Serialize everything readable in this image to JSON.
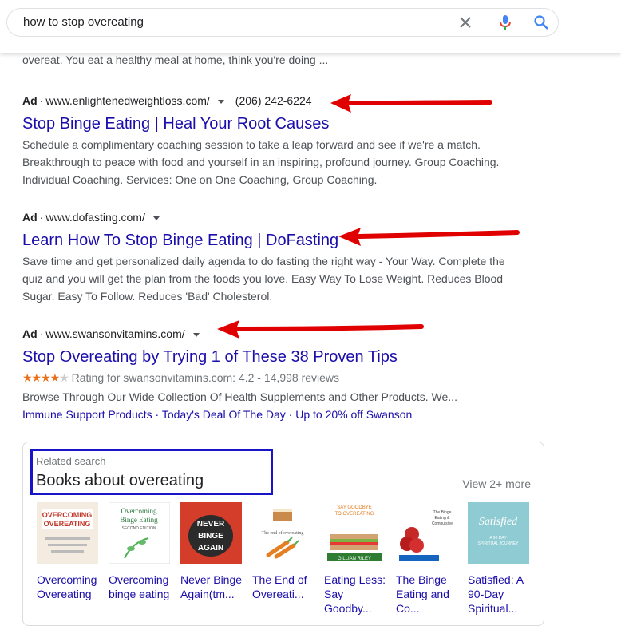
{
  "search": {
    "query": "how to stop overeating"
  },
  "top_snippet": "overeat. You eat a healthy meal at home, think you're doing ...",
  "ads": [
    {
      "label": "Ad",
      "url": "www.enlightenedweightloss.com/",
      "phone": "(206) 242-6224",
      "title": "Stop Binge Eating | Heal Your Root Causes",
      "desc_lines": [
        "Schedule a complimentary coaching session to take a leap forward and see if we're a match.",
        "Breakthrough to peace with food and yourself in an inspiring, profound journey. Group Coaching.",
        "Individual Coaching. Services: One on One Coaching, Group Coaching."
      ]
    },
    {
      "label": "Ad",
      "url": "www.dofasting.com/",
      "title": "Learn How To Stop Binge Eating | DoFasting",
      "desc_lines": [
        "Save time and get personalized daily agenda to do fasting the right way - Your Way. Complete the",
        "quiz and you will get the plan from the foods you love. Easy Way To Lose Weight. Reduces Blood",
        "Sugar. Easy To Follow. Reduces 'Bad' Cholesterol."
      ]
    },
    {
      "label": "Ad",
      "url": "www.swansonvitamins.com/",
      "title": "Stop Overeating by Trying 1 of These 38 Proven Tips",
      "rating_text": "Rating for swansonvitamins.com: 4.2 - 14,998 reviews",
      "rating_value": 4.2,
      "desc_lines": [
        "Browse Through Our Wide Collection Of Health Supplements and Other Products. We..."
      ],
      "sitelinks": [
        "Immune Support Products",
        "Today's Deal Of The Day",
        "Up to 20% off Swanson"
      ]
    }
  ],
  "related": {
    "small_label": "Related search",
    "title": "Books about overeating",
    "view_more": "View 2+ more",
    "books": [
      {
        "title_lines": [
          "Overcoming",
          "Overeating"
        ],
        "cover_text": "OVERCOMING OVEREATING",
        "cover_bg": "#f4ece0"
      },
      {
        "title_lines": [
          "Overcoming",
          "binge eating"
        ],
        "cover_text": "Overcoming Binge Eating",
        "cover_bg": "#ffffff"
      },
      {
        "title_lines": [
          "Never Binge",
          "Again(tm..."
        ],
        "cover_text": "NEVER BINGE AGAIN",
        "cover_bg": "#d33d2a"
      },
      {
        "title_lines": [
          "The End of",
          "Overeati..."
        ],
        "cover_text": "The end of overeating",
        "cover_bg": "#ffffff"
      },
      {
        "title_lines": [
          "Eating Less:",
          "Say",
          "Goodby..."
        ],
        "cover_text": "SAY GOODBYE TO OVEREATING",
        "cover_bg": "#ffffff"
      },
      {
        "title_lines": [
          "The Binge",
          "Eating and",
          "Co..."
        ],
        "cover_text": "The Binge Eating & Compulsive Overeating Workbook",
        "cover_bg": "#ffffff"
      },
      {
        "title_lines": [
          "Satisfied: A",
          "90-Day",
          "Spiritual..."
        ],
        "cover_text": "Satisfied",
        "cover_bg": "#8fcbd3"
      }
    ]
  },
  "colors": {
    "link": "#1a0dab",
    "snippet": "#4d5156",
    "arrow": "#e00000",
    "highlight": "#1a14c8",
    "star": "#e7711b"
  }
}
